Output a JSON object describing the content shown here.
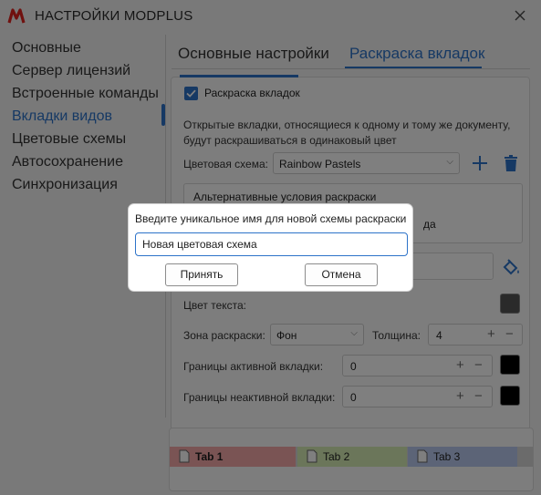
{
  "window": {
    "title": "НАСТРОЙКИ MODPLUS"
  },
  "sidebar": {
    "items": [
      {
        "label": "Основные"
      },
      {
        "label": "Сервер лицензий"
      },
      {
        "label": "Встроенные команды"
      },
      {
        "label": "Вкладки видов",
        "active": true
      },
      {
        "label": "Цветовые схемы"
      },
      {
        "label": "Автосохранение"
      },
      {
        "label": "Синхронизация"
      }
    ]
  },
  "tabs": [
    {
      "label": "Основные настройки"
    },
    {
      "label": "Раскраска вкладок",
      "active": true
    }
  ],
  "settings": {
    "colorize_checkbox_label": "Раскраска вкладок",
    "colorize_checked": true,
    "description": "Открытые вкладки, относящиеся к одному и тому же документу, будут раскрашиваться в одинаковый цвет",
    "scheme_label": "Цветовая схема:",
    "scheme_value": "Rainbow Pastels",
    "conditions_title": "Альтернативные условия раскраски",
    "conditions_tail": "да",
    "text_color_label": "Цвет текста:",
    "zone_label": "Зона раскраски:",
    "zone_value": "Фон",
    "thickness_label": "Толщина:",
    "thickness_value": "4",
    "active_border_label": "Границы активной вкладки:",
    "active_border_value": "0",
    "inactive_border_label": "Границы неактивной вкладки:",
    "inactive_border_value": "0"
  },
  "preview": {
    "tabs": [
      {
        "label": "Tab 1",
        "color": "#f4a8a8"
      },
      {
        "label": "Tab 2",
        "color": "#d6edb4"
      },
      {
        "label": "Tab 3",
        "color": "#b9c9ee"
      }
    ]
  },
  "dialog": {
    "prompt": "Введите уникальное имя для новой схемы раскраски",
    "input_value": "Новая цветовая схема",
    "ok_label": "Принять",
    "cancel_label": "Отмена"
  },
  "colors": {
    "accent": "#2d73c9",
    "overlay": "rgba(0,0,0,0.5)"
  }
}
